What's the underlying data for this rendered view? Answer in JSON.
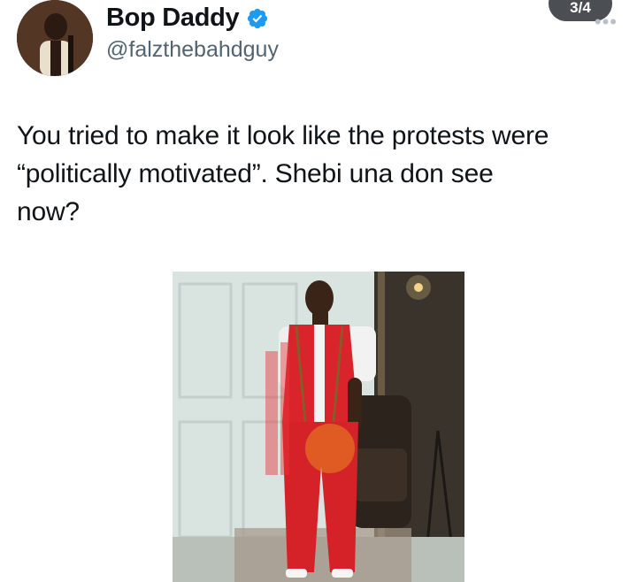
{
  "author": {
    "display_name": "Bop Daddy",
    "handle": "@falzthebahdguy",
    "verified": true
  },
  "header": {
    "page_indicator": "3/4",
    "more_label": "•••"
  },
  "tweet": {
    "text": "You tried to make it look like the protests were\n“politically motivated”. Shebi una don see\nnow?"
  },
  "colors": {
    "verified_blue": "#1d9bf0",
    "text_primary": "#0f1419",
    "text_secondary": "#536471",
    "outfit_red": "#d8242a"
  },
  "icons": [
    "verified-badge-icon",
    "more-options-icon"
  ]
}
